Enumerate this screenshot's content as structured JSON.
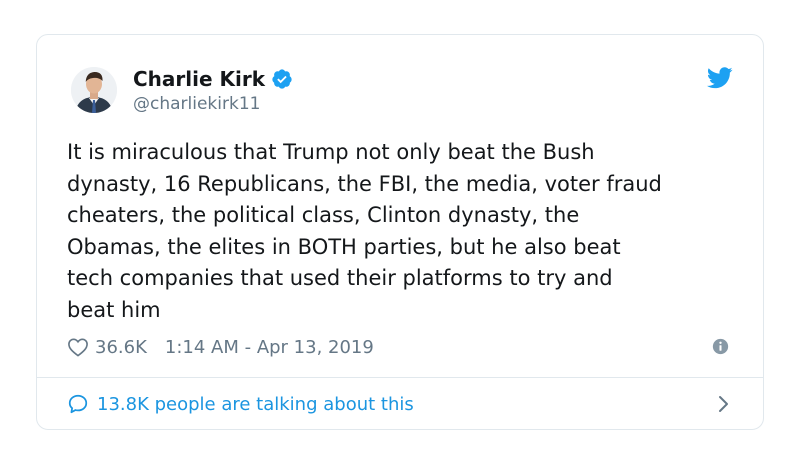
{
  "tweet": {
    "display_name": "Charlie Kirk",
    "handle": "@charliekirk11",
    "verified": true,
    "text_lines": [
      "It is miraculous that Trump not only beat the Bush",
      "dynasty, 16 Republicans, the FBI, the media, voter fraud",
      "cheaters, the political class, Clinton dynasty, the",
      "Obamas, the elites in BOTH parties, but he also beat",
      "tech companies that used their platforms to try and",
      "beat him"
    ],
    "likes": "36.6K",
    "timestamp": "1:14 AM - Apr 13, 2019"
  },
  "footer": {
    "talking_text": "13.8K people are talking about this"
  },
  "icons": {
    "brand": "twitter-bird-icon",
    "verified": "verified-badge-icon",
    "like": "heart-icon",
    "info": "info-icon",
    "reply": "speech-bubble-icon",
    "chevron": "chevron-right-icon"
  },
  "colors": {
    "brand_blue": "#1da1f2",
    "link_blue": "#1b95e0",
    "text": "#14171a",
    "muted": "#657786",
    "border": "#e1e8ed"
  }
}
